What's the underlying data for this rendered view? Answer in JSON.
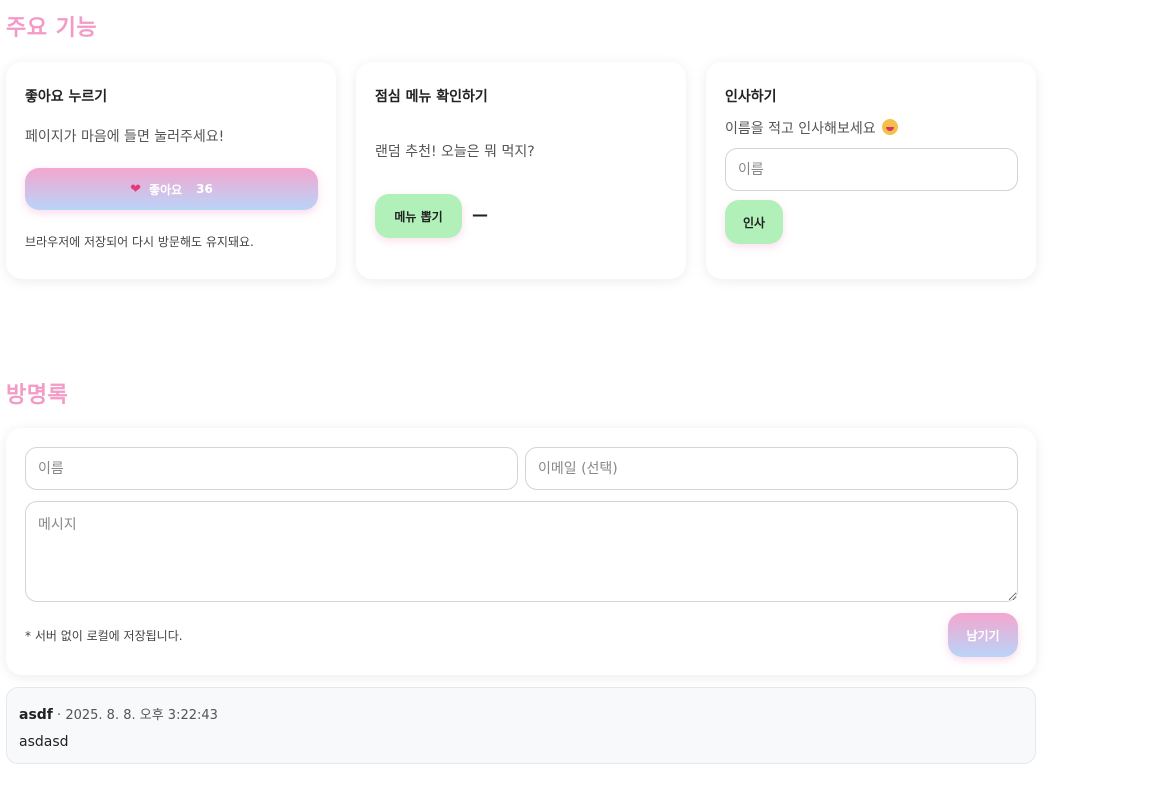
{
  "features": {
    "title": "주요 기능",
    "like": {
      "title": "좋아요 누르기",
      "description": "페이지가 마음에 들면 눌러주세요!",
      "button_label": "좋아요",
      "count": "36",
      "note": "브라우저에 저장되어 다시 방문해도 유지돼요."
    },
    "lunch": {
      "title": "점심 메뉴 확인하기",
      "description": "랜덤 추천! 오늘은 뭐 먹지?",
      "button_label": "메뉴 뽑기",
      "result": "—"
    },
    "greet": {
      "title": "인사하기",
      "description": "이름을 적고 인사해보세요",
      "name_placeholder": "이름",
      "button_label": "인사"
    }
  },
  "guestbook": {
    "title": "방명록",
    "name_placeholder": "이름",
    "email_placeholder": "이메일 (선택)",
    "message_placeholder": "메시지",
    "note": "* 서버 없이 로컬에 저장됩니다.",
    "submit_label": "남기기",
    "entries": [
      {
        "name": "asdf",
        "separator": "·",
        "timestamp": "2025. 8. 8. 오후 3:22:43",
        "message": "asdasd"
      }
    ]
  },
  "colors": {
    "accent_pink": "#f39ac6",
    "green_button": "#b1f1b9",
    "gradient_start": "#f3a6cf",
    "gradient_end": "#b9d4f8"
  }
}
